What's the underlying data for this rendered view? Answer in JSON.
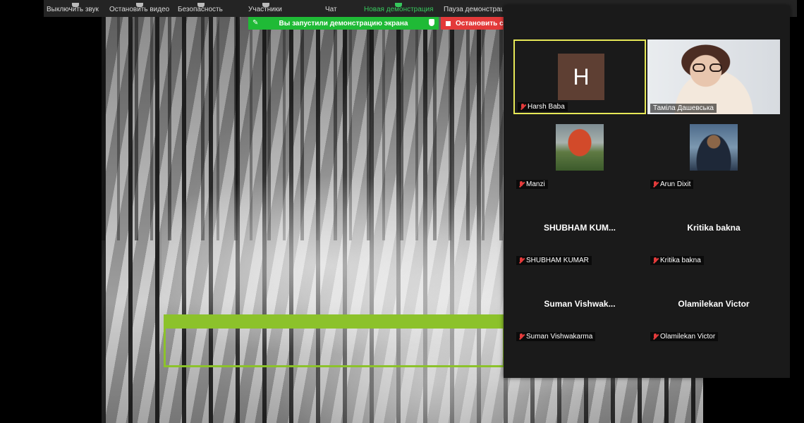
{
  "toolbar": {
    "items": [
      {
        "label": "Выключить звук",
        "icon": "mic-icon"
      },
      {
        "label": "Остановить видео",
        "icon": "video-icon"
      },
      {
        "label": "Безопасность",
        "icon": "shield-icon"
      },
      {
        "label": "Участники",
        "icon": "participants-icon"
      },
      {
        "label": "Чат",
        "icon": "chat-icon"
      },
      {
        "label": "Новая демонстрация",
        "icon": "share-screen-icon",
        "active": true
      },
      {
        "label": "Пауза демонстрации",
        "icon": "pause-icon"
      }
    ],
    "active_color": "#37c75d"
  },
  "share_banner": {
    "text": "Вы запустили демонстрацию экрана",
    "stop_label": "Остановить совместное использование",
    "color": "#1fba36",
    "stop_color": "#e33a3a"
  },
  "annotation": {
    "color": "#8cc22b"
  },
  "gallery": {
    "highlight_color": "#e6e857",
    "tiles": [
      {
        "name": "Harsh Baba",
        "avatar_letter": "H",
        "muted": true,
        "type": "avatar",
        "highlighted": true
      },
      {
        "name": "Таміла Дашевська",
        "muted": false,
        "type": "video"
      },
      {
        "name": "Manzi",
        "muted": true,
        "type": "photo"
      },
      {
        "name": "Arun Dixit",
        "muted": true,
        "type": "photo"
      },
      {
        "name": "SHUBHAM KUMAR",
        "display": "SHUBHAM  KUM...",
        "muted": true,
        "type": "name"
      },
      {
        "name": "Kritika bakna",
        "display": "Kritika bakna",
        "muted": true,
        "type": "name"
      },
      {
        "name": "Suman Vishwakarma",
        "display": "Suman  Vishwak...",
        "muted": true,
        "type": "name"
      },
      {
        "name": "Olamilekan Victor",
        "display": "Olamilekan Victor",
        "muted": true,
        "type": "name"
      }
    ]
  }
}
